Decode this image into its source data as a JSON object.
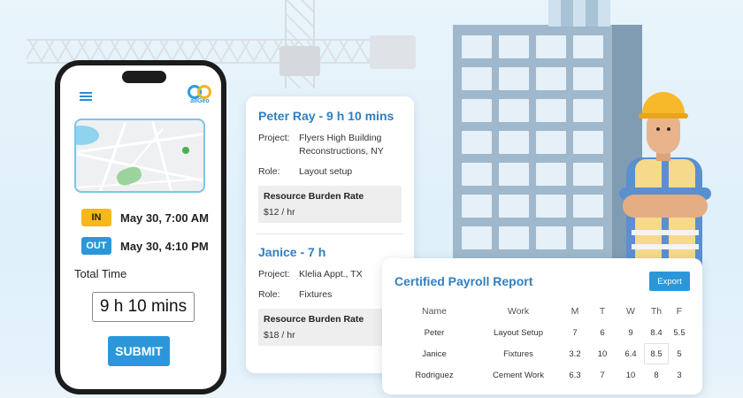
{
  "phone": {
    "logo_text": "allGeo",
    "clock_in": {
      "tag": "IN",
      "time": "May 30, 7:00 AM"
    },
    "clock_out": {
      "tag": "OUT",
      "time": "May 30, 4:10 PM"
    },
    "total_label": "Total Time",
    "total_value": "9 h 10 mins",
    "submit_label": "SUBMIT"
  },
  "timesheets": [
    {
      "title": "Peter Ray - 9 h 10 mins",
      "project_key": "Project:",
      "project": "Flyers High Building Reconstructions, NY",
      "role_key": "Role:",
      "role": "Layout setup",
      "rate_title": "Resource Burden Rate",
      "rate": "$12 / hr"
    },
    {
      "title": "Janice - 7 h",
      "project_key": "Project:",
      "project": "Klelia Appt., TX",
      "role_key": "Role:",
      "role": "Fixtures",
      "rate_title": "Resource Burden Rate",
      "rate": "$18 / hr"
    }
  ],
  "report": {
    "title": "Certified Payroll Report",
    "export_label": "Export",
    "columns": [
      "Name",
      "Work",
      "M",
      "T",
      "W",
      "Th",
      "F"
    ],
    "rows": [
      [
        "Peter",
        "Layout Setup",
        "7",
        "6",
        "9",
        "8.4",
        "5.5"
      ],
      [
        "Janice",
        "Fixtures",
        "3.2",
        "10",
        "6.4",
        "8.5",
        "5"
      ],
      [
        "Rodriguez",
        "Cement Work",
        "6.3",
        "7",
        "10",
        "8",
        "3"
      ]
    ]
  },
  "colors": {
    "accent_blue": "#2b97d9",
    "title_blue": "#2f7fc1",
    "in_tag": "#f6b81a",
    "out_tag": "#2a98d8"
  }
}
